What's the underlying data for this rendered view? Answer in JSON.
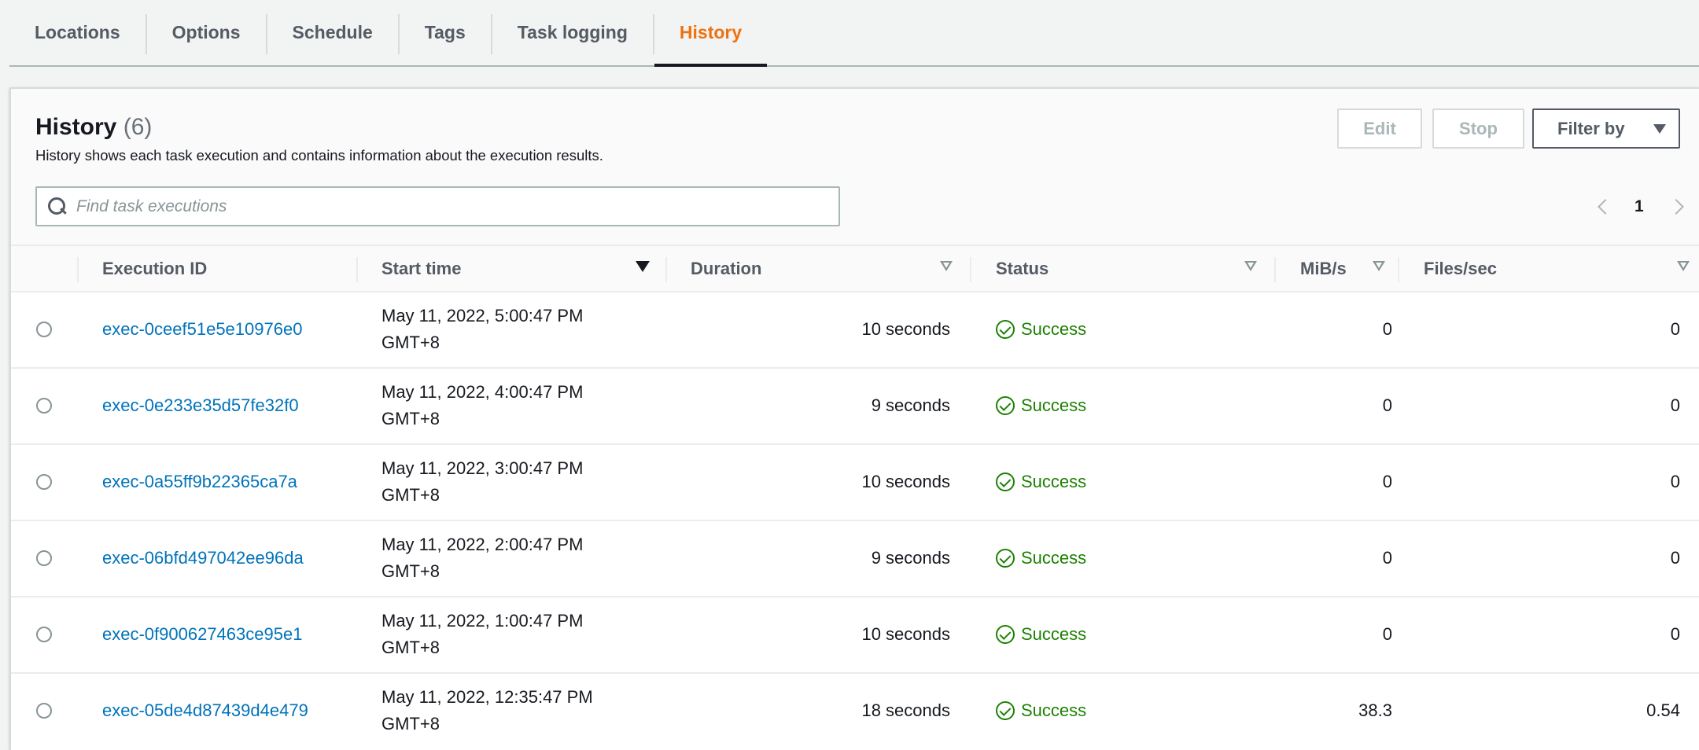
{
  "tabs": [
    {
      "label": "Locations"
    },
    {
      "label": "Options"
    },
    {
      "label": "Schedule"
    },
    {
      "label": "Tags"
    },
    {
      "label": "Task logging"
    },
    {
      "label": "History"
    }
  ],
  "active_tab": "History",
  "panel": {
    "title": "History",
    "count": "(6)",
    "description": "History shows each task execution and contains information about the execution results.",
    "buttons": {
      "edit": "Edit",
      "stop": "Stop",
      "filter": "Filter by"
    },
    "search_placeholder": "Find task executions",
    "page": "1"
  },
  "table": {
    "columns": {
      "execution_id": "Execution ID",
      "start_time": "Start time",
      "duration": "Duration",
      "status": "Status",
      "mibs": "MiB/s",
      "files_sec": "Files/sec"
    },
    "rows": [
      {
        "id": "exec-0ceef51e5e10976e0",
        "start1": "May 11, 2022, 5:00:47 PM",
        "start2": "GMT+8",
        "duration": "10 seconds",
        "status": "Success",
        "mibs": "0",
        "files": "0"
      },
      {
        "id": "exec-0e233e35d57fe32f0",
        "start1": "May 11, 2022, 4:00:47 PM",
        "start2": "GMT+8",
        "duration": "9 seconds",
        "status": "Success",
        "mibs": "0",
        "files": "0"
      },
      {
        "id": "exec-0a55ff9b22365ca7a",
        "start1": "May 11, 2022, 3:00:47 PM",
        "start2": "GMT+8",
        "duration": "10 seconds",
        "status": "Success",
        "mibs": "0",
        "files": "0"
      },
      {
        "id": "exec-06bfd497042ee96da",
        "start1": "May 11, 2022, 2:00:47 PM",
        "start2": "GMT+8",
        "duration": "9 seconds",
        "status": "Success",
        "mibs": "0",
        "files": "0"
      },
      {
        "id": "exec-0f900627463ce95e1",
        "start1": "May 11, 2022, 1:00:47 PM",
        "start2": "GMT+8",
        "duration": "10 seconds",
        "status": "Success",
        "mibs": "0",
        "files": "0"
      },
      {
        "id": "exec-05de4d87439d4e479",
        "start1": "May 11, 2022, 12:35:47 PM",
        "start2": "GMT+8",
        "duration": "18 seconds",
        "status": "Success",
        "mibs": "38.3",
        "files": "0.54"
      }
    ]
  },
  "colors": {
    "accent": "#ec7211",
    "link": "#0073bb",
    "success": "#1d8102"
  }
}
